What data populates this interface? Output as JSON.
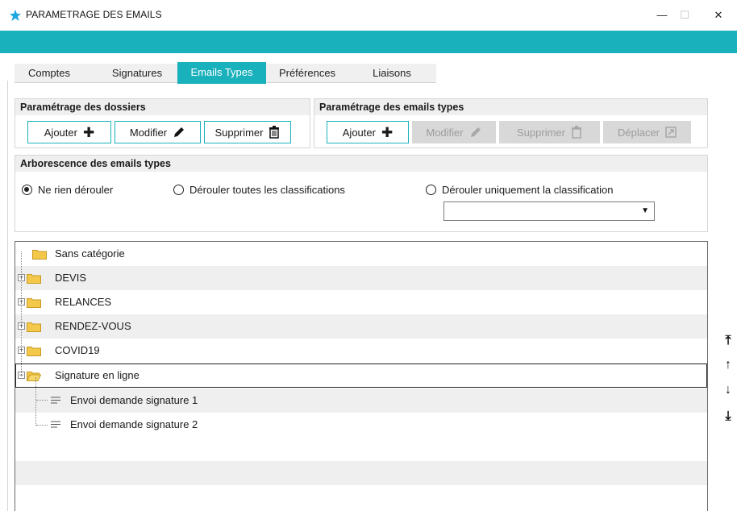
{
  "window": {
    "title": "PARAMETRAGE DES EMAILS",
    "minimize": "—",
    "maximize": "☐",
    "close": "✕"
  },
  "tabs": [
    {
      "label": "Comptes",
      "active": false
    },
    {
      "label": "Signatures",
      "active": false
    },
    {
      "label": "Emails Types",
      "active": true
    },
    {
      "label": "Préférences",
      "active": false
    },
    {
      "label": "Liaisons",
      "active": false
    }
  ],
  "folders_panel": {
    "title": "Paramétrage des dossiers",
    "add": "Ajouter",
    "edit": "Modifier",
    "delete": "Supprimer"
  },
  "emails_panel": {
    "title": "Paramétrage des emails types",
    "add": "Ajouter",
    "edit": "Modifier",
    "delete": "Supprimer",
    "move": "Déplacer"
  },
  "tree_options": {
    "title": "Arborescence des emails types",
    "option_none": "Ne rien dérouler",
    "option_all": "Dérouler toutes les classifications",
    "option_only": "Dérouler uniquement la classification",
    "selected": "option_none",
    "classification_value": ""
  },
  "tree": {
    "items": [
      {
        "label": "Sans catégorie"
      },
      {
        "label": "DEVIS"
      },
      {
        "label": "RELANCES"
      },
      {
        "label": "RENDEZ-VOUS"
      },
      {
        "label": "COVID19"
      },
      {
        "label": "Signature en ligne"
      },
      {
        "label": "Envoi demande signature 1"
      },
      {
        "label": "Envoi demande signature 2"
      }
    ]
  },
  "move_buttons": {
    "top": "⤒",
    "up": "↑",
    "down": "↓",
    "bottom": "⤓"
  },
  "colors": {
    "accent": "#19b1bc",
    "disabled": "#d8d8d8",
    "folder": "#f3c84b"
  }
}
